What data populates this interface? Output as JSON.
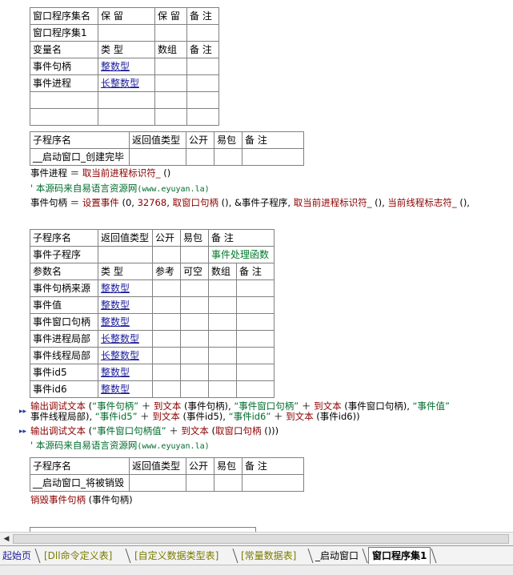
{
  "window_set": {
    "header": [
      "窗口程序集名",
      "保 留",
      "保 留",
      "备 注"
    ],
    "name": "窗口程序集1",
    "var_header": [
      "变量名",
      "类 型",
      "数组",
      "备 注"
    ],
    "vars": [
      {
        "name": "事件句柄",
        "type": "整数型"
      },
      {
        "name": "事件进程",
        "type": "长整数型"
      }
    ]
  },
  "sub1": {
    "header": [
      "子程序名",
      "返回值类型",
      "公开",
      "易包",
      "备 注"
    ],
    "name": "__启动窗口_创建完毕",
    "code": {
      "l1_a": "事件进程",
      "l1_b": " ＝ ",
      "l1_c": "取当前进程标识符_",
      " l1_d": "",
      "l1_d": " ()",
      "l2_a": "'  本源码来自易语言资源网",
      "l2_b": "(www.eyuyan.la)",
      "l3_a": "事件句柄",
      "l3_b": " ＝ ",
      "l3_c": "设置事件",
      "l3_d": " (0, ",
      "l3_e": "32768",
      "l3_f": ", ",
      "l3_g": "取窗口句柄",
      "l3_h": " (), &事件子程序, ",
      "l3_i": "取当前进程标识符_",
      "l3_j": " (), ",
      "l3_k": "当前线程标志符_",
      "l3_l": " (),"
    }
  },
  "sub2": {
    "header": [
      "子程序名",
      "返回值类型",
      "公开",
      "易包",
      "备 注"
    ],
    "name": "事件子程序",
    "remark": "事件处理函数",
    "param_header": [
      "参数名",
      "类 型",
      "参考",
      "可空",
      "数组",
      "备 注"
    ],
    "params": [
      {
        "name": "事件句柄来源",
        "type": "整数型"
      },
      {
        "name": "事件值",
        "type": "整数型"
      },
      {
        "name": "事件窗口句柄",
        "type": "整数型"
      },
      {
        "name": "事件进程局部",
        "type": "长整数型"
      },
      {
        "name": "事件线程局部",
        "type": "长整数型"
      },
      {
        "name": "事件id5",
        "type": "整数型"
      },
      {
        "name": "事件id6",
        "type": "整数型"
      }
    ],
    "code": {
      "l1_a": "输出调试文本",
      "l1_b": " (",
      "l1_c": "“事件句柄”",
      "l1_d": " ＋ ",
      "l1_e": "到文本",
      "l1_f": " (事件句柄), ",
      "l1_g": "“事件窗口句柄”",
      "l1_h": " ＋ ",
      "l1_i": "到文本",
      "l1_j": " (事件窗口句柄), ",
      "l1_k": "“事件值”",
      "l2_a": "事件线程局部), ",
      "l2_b": "“事件id5”",
      "l2_c": " ＋ ",
      "l2_d": "到文本",
      "l2_e": " (事件id5), ",
      "l2_f": "“事件id6”",
      "l2_g": " ＋ ",
      "l2_h": "到文本",
      "l2_i": " (事件id6))",
      "l3_a": "输出调试文本",
      "l3_b": " (",
      "l3_c": "“事件窗口句柄值”",
      "l3_d": " ＋ ",
      "l3_e": "到文本",
      "l3_f": " (",
      "l3_g": "取窗口句柄",
      "l3_h": " ()))",
      "l4_a": "'  本源码来自易语言资源网",
      "l4_b": "(www.eyuyan.la)"
    }
  },
  "sub3": {
    "header": [
      "子程序名",
      "返回值类型",
      "公开",
      "易包",
      "备 注"
    ],
    "name": "__启动窗口_将被销毁",
    "code": {
      "l1_a": "销毁事件句柄",
      "l1_b": " (事件句柄)"
    }
  },
  "tabs": [
    {
      "label": "起始页",
      "color": "#1c1c9c"
    },
    {
      "label": "[Dll命令定义表]",
      "color": "#7a7a00"
    },
    {
      "label": "[自定义数据类型表]",
      "color": "#7a7a00"
    },
    {
      "label": "[常量数据表]",
      "color": "#7a7a00"
    },
    {
      "label": "_启动窗口",
      "color": "#000000"
    },
    {
      "label": "窗口程序集1",
      "color": "#000000"
    }
  ],
  "icons": {
    "arrow": "▸▸",
    "scroll_left": "◀"
  }
}
